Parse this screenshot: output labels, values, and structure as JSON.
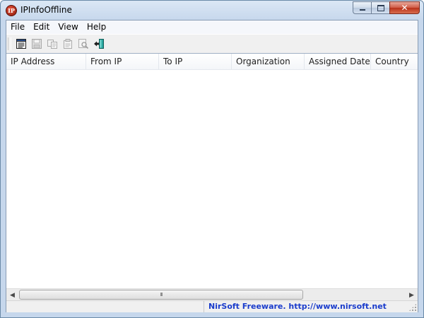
{
  "window": {
    "title": "IPInfoOffline",
    "icon_text": "IP",
    "icon": "app-ip-icon",
    "controls": [
      "minimize-icon",
      "maximize-icon",
      "close-icon"
    ]
  },
  "menu": {
    "items": [
      {
        "label": "File"
      },
      {
        "label": "Edit"
      },
      {
        "label": "View"
      },
      {
        "label": "Help"
      }
    ]
  },
  "toolbar": {
    "buttons": [
      {
        "icon": "html-report-icon",
        "enabled": true
      },
      {
        "icon": "save-icon",
        "enabled": false
      },
      {
        "icon": "copy-icon",
        "enabled": false
      },
      {
        "icon": "properties-icon",
        "enabled": false
      },
      {
        "icon": "find-icon",
        "enabled": false
      },
      {
        "icon": "exit-icon",
        "enabled": true
      }
    ]
  },
  "list": {
    "columns": [
      {
        "label": "IP Address"
      },
      {
        "label": "From IP"
      },
      {
        "label": "To IP"
      },
      {
        "label": "Organization"
      },
      {
        "label": "Assigned Date"
      },
      {
        "label": "Country"
      }
    ],
    "rows": []
  },
  "scrollbar": {
    "grip": "III"
  },
  "status": {
    "link_text": "NirSoft Freeware.  http://www.nirsoft.net"
  },
  "colors": {
    "link": "#1a3ccc",
    "close_button": "#c8432a",
    "title_bar": "#c6d7ec"
  }
}
